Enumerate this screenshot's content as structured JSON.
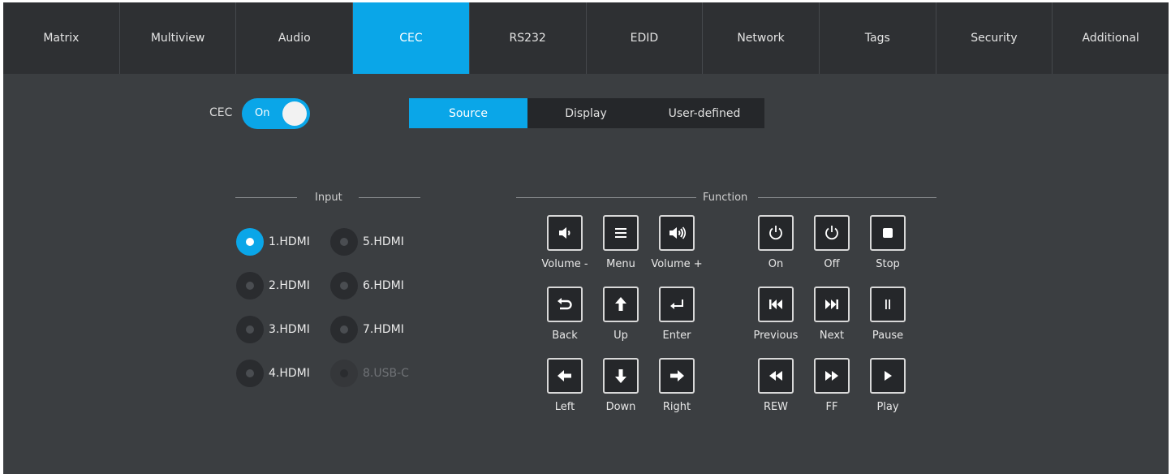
{
  "nav": {
    "tabs": [
      {
        "label": "Matrix"
      },
      {
        "label": "Multiview"
      },
      {
        "label": "Audio"
      },
      {
        "label": "CEC"
      },
      {
        "label": "RS232"
      },
      {
        "label": "EDID"
      },
      {
        "label": "Network"
      },
      {
        "label": "Tags"
      },
      {
        "label": "Security"
      },
      {
        "label": "Additional"
      }
    ],
    "active": "CEC"
  },
  "cec": {
    "label": "CEC",
    "toggle_text": "On",
    "enabled": true
  },
  "subtabs": {
    "items": [
      {
        "label": "Source"
      },
      {
        "label": "Display"
      },
      {
        "label": "User-defined"
      }
    ],
    "active": "Source"
  },
  "input": {
    "title": "Input",
    "options": [
      {
        "label": "1.HDMI",
        "checked": true,
        "disabled": false
      },
      {
        "label": "2.HDMI",
        "checked": false,
        "disabled": false
      },
      {
        "label": "3.HDMI",
        "checked": false,
        "disabled": false
      },
      {
        "label": "4.HDMI",
        "checked": false,
        "disabled": false
      },
      {
        "label": "5.HDMI",
        "checked": false,
        "disabled": false
      },
      {
        "label": "6.HDMI",
        "checked": false,
        "disabled": false
      },
      {
        "label": "7.HDMI",
        "checked": false,
        "disabled": false
      },
      {
        "label": "8.USB-C",
        "checked": false,
        "disabled": true
      }
    ]
  },
  "function": {
    "title": "Function",
    "buttons": [
      {
        "label": "Volume -",
        "icon": "volume-down-icon"
      },
      {
        "label": "Menu",
        "icon": "menu-icon"
      },
      {
        "label": "Volume +",
        "icon": "volume-up-icon"
      },
      {
        "label": "On",
        "icon": "power-icon"
      },
      {
        "label": "Off",
        "icon": "power-icon"
      },
      {
        "label": "Stop",
        "icon": "stop-icon"
      },
      {
        "label": "Back",
        "icon": "back-icon"
      },
      {
        "label": "Up",
        "icon": "arrow-up-icon"
      },
      {
        "label": "Enter",
        "icon": "enter-icon"
      },
      {
        "label": "Previous",
        "icon": "previous-icon"
      },
      {
        "label": "Next",
        "icon": "next-icon"
      },
      {
        "label": "Pause",
        "icon": "pause-icon"
      },
      {
        "label": "Left",
        "icon": "arrow-left-icon"
      },
      {
        "label": "Down",
        "icon": "arrow-down-icon"
      },
      {
        "label": "Right",
        "icon": "arrow-right-icon"
      },
      {
        "label": "REW",
        "icon": "rewind-icon"
      },
      {
        "label": "FF",
        "icon": "fast-forward-icon"
      },
      {
        "label": "Play",
        "icon": "play-icon"
      }
    ]
  },
  "colors": {
    "accent": "#0aa6e8",
    "background": "#3b3e41",
    "nav_background": "#2e3033"
  }
}
